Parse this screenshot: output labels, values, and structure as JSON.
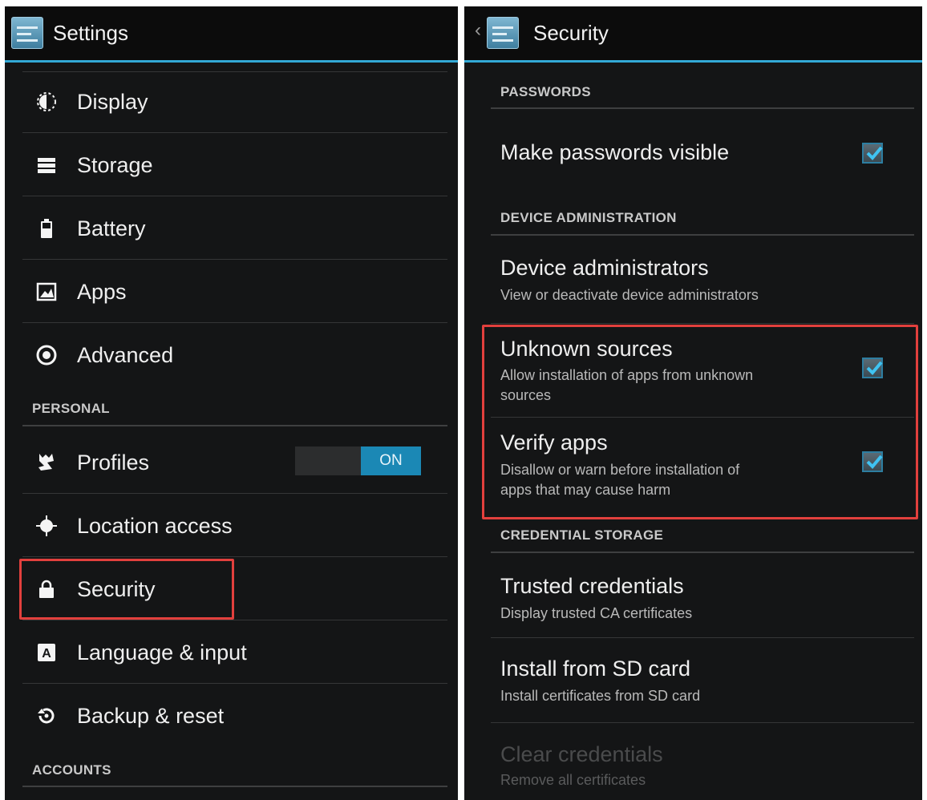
{
  "left": {
    "title": "Settings",
    "items": [
      {
        "label": "Display",
        "icon": "display-brightness-icon"
      },
      {
        "label": "Storage",
        "icon": "storage-icon"
      },
      {
        "label": "Battery",
        "icon": "battery-icon"
      },
      {
        "label": "Apps",
        "icon": "apps-icon"
      },
      {
        "label": "Advanced",
        "icon": "advanced-icon"
      }
    ],
    "personal_header": "PERSONAL",
    "personal_items": [
      {
        "label": "Profiles",
        "icon": "profiles-icon",
        "toggle": "ON"
      },
      {
        "label": "Location access",
        "icon": "location-icon"
      },
      {
        "label": "Security",
        "icon": "lock-icon"
      },
      {
        "label": "Language & input",
        "icon": "language-icon"
      },
      {
        "label": "Backup & reset",
        "icon": "backup-icon"
      }
    ],
    "accounts_header": "ACCOUNTS"
  },
  "right": {
    "title": "Security",
    "sections": {
      "passwords": "PASSWORDS",
      "device_admin": "DEVICE ADMINISTRATION",
      "credential_storage": "CREDENTIAL STORAGE"
    },
    "prefs": {
      "make_passwords_visible": {
        "title": "Make passwords visible",
        "checked": true
      },
      "device_administrators": {
        "title": "Device administrators",
        "summary": "View or deactivate device administrators"
      },
      "unknown_sources": {
        "title": "Unknown sources",
        "summary_1": "Allow installation of apps from unknown",
        "summary_2": "sources",
        "checked": true
      },
      "verify_apps": {
        "title": "Verify apps",
        "summary_1": "Disallow or warn before installation of",
        "summary_2": "apps that may cause harm",
        "checked": true
      },
      "trusted_credentials": {
        "title": "Trusted credentials",
        "summary": "Display trusted CA certificates"
      },
      "install_from_sd": {
        "title": "Install from SD card",
        "summary": "Install certificates from SD card"
      },
      "clear_credentials": {
        "title": "Clear credentials",
        "summary": "Remove all certificates",
        "enabled": false
      }
    }
  },
  "colors": {
    "accent": "#33a9d6",
    "highlight": "#e2403d",
    "background": "#141516"
  }
}
